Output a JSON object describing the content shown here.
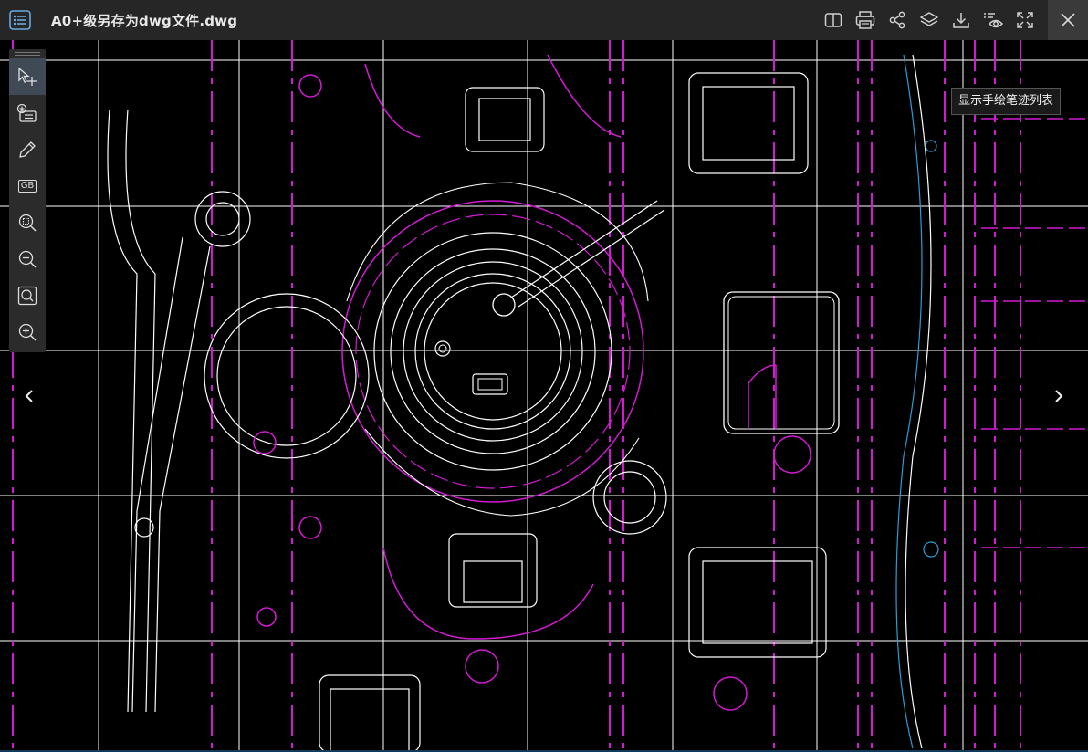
{
  "app": {
    "title": "A0+级另存为dwg文件.dwg"
  },
  "toolbar": {
    "buttons": [
      {
        "icon": "split-view-icon"
      },
      {
        "icon": "printer-icon"
      },
      {
        "icon": "share-icon"
      },
      {
        "icon": "layers-icon"
      },
      {
        "icon": "download-icon"
      },
      {
        "icon": "hand-drawn-list-icon"
      },
      {
        "icon": "fullscreen-icon"
      }
    ],
    "tooltip": "显示手绘笔迹列表"
  },
  "left_tools": [
    {
      "icon": "select-move-icon",
      "active": true
    },
    {
      "icon": "add-note-icon"
    },
    {
      "icon": "pencil-icon"
    },
    {
      "icon": "gb-standard-icon",
      "label": "GB"
    },
    {
      "icon": "zoom-window-icon"
    },
    {
      "icon": "zoom-out-icon"
    },
    {
      "icon": "zoom-extents-icon"
    },
    {
      "icon": "zoom-in-icon"
    }
  ],
  "colors": {
    "topbar": "#262626",
    "drawing_background": "#000000",
    "line_white": "#ffffff",
    "line_magenta": "#d21ad2",
    "line_blue": "#2e9bd8"
  }
}
